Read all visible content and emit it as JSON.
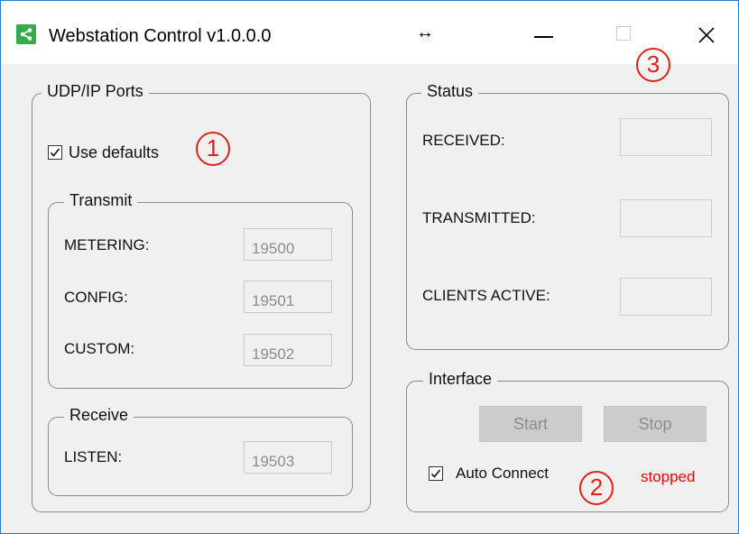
{
  "window": {
    "title": "Webstation Control v1.0.0.0",
    "resize_cursor_glyph": "↔"
  },
  "ports": {
    "legend": "UDP/IP Ports",
    "use_defaults": {
      "label": "Use defaults",
      "checked": true
    },
    "transmit": {
      "legend": "Transmit",
      "metering": {
        "label": "METERING:",
        "value": "19500"
      },
      "config": {
        "label": "CONFIG:",
        "value": "19501"
      },
      "custom": {
        "label": "CUSTOM:",
        "value": "19502"
      }
    },
    "receive": {
      "legend": "Receive",
      "listen": {
        "label": "LISTEN:",
        "value": "19503"
      }
    }
  },
  "status": {
    "legend": "Status",
    "received_label": "RECEIVED:",
    "received_value": "",
    "transmitted_label": "TRANSMITTED:",
    "transmitted_value": "",
    "clients_active_label": "CLIENTS ACTIVE:",
    "clients_active_value": ""
  },
  "interface": {
    "legend": "Interface",
    "start_label": "Start",
    "stop_label": "Stop",
    "auto_connect": {
      "label": "Auto Connect",
      "checked": true
    },
    "state_text": "stopped"
  },
  "annotations": {
    "one": "1",
    "two": "2",
    "three": "3"
  },
  "colors": {
    "annotation_red": "#e0201c",
    "status_red": "#ff0000",
    "app_icon_green": "#3aa94b",
    "window_border_blue": "#2b7bd6"
  },
  "icons": {
    "app": "share-icon",
    "minimize": "minimize-icon",
    "maximize": "maximize-icon",
    "close": "close-icon"
  }
}
